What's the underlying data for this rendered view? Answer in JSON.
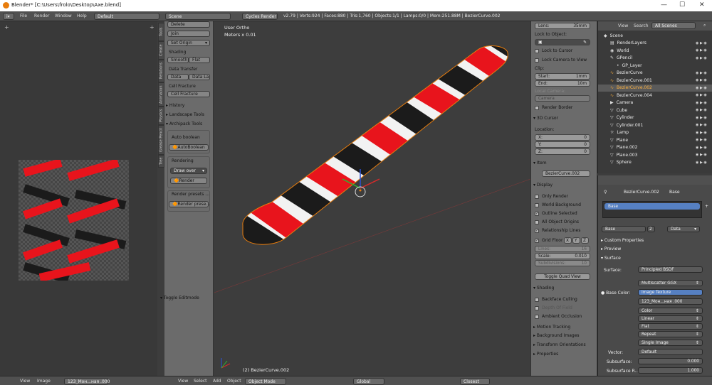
{
  "window": {
    "title": "Blender* [C:\\Users\\frolo\\Desktop\\Axe.blend]"
  },
  "menu": [
    "File",
    "Render",
    "Window",
    "Help"
  ],
  "layout": "Default",
  "scene": "Scene",
  "engine": "Cycles Render",
  "stats": "v2.79 | Verts:924 | Faces:880 | Tris:1,760 | Objects:1/1 | Lamps:0/0 | Mem:251.88M | BezierCurve.002",
  "tool_tabs": [
    "Tools",
    "Create",
    "Relations",
    "Animation",
    "Physics",
    "Grease Pencil",
    "Tree"
  ],
  "toolshelf": {
    "delete": "Delete",
    "join": "Join",
    "set_origin": "Set Origin",
    "shading": "Shading",
    "smooth": "Smooth",
    "flat": "Flat",
    "data_transfer": "Data Transfer",
    "data": "Data",
    "data_la": "Data La",
    "cell_fracture_lbl": "Cell Fracture",
    "cell_fracture_btn": "Cell Fracture",
    "history": "History",
    "landscape": "Landscape Tools",
    "archipack": "Archipack Tools",
    "auto_boolean_lbl": "Auto boolean",
    "auto_boolean_btn": "AutoBoolean",
    "rendering": "Rendering",
    "draw_over": "Draw over",
    "render": "Render",
    "render_presets_lbl": "Render presets ...",
    "render_presets_btn": "Render prese...",
    "toggle_editmode": "Toggle Editmode"
  },
  "viewport": {
    "view_name": "User Ortho",
    "scale": "Meters x 0.01",
    "object_label": "(2) BezierCurve.002"
  },
  "npanel": {
    "lens_lbl": "Lens:",
    "lens_val": "35mm",
    "lock_obj": "Lock to Object:",
    "lock_cursor": "Lock to Cursor",
    "lock_camera": "Lock Camera to View",
    "clip": "Clip:",
    "start_lbl": "Start:",
    "start_val": "1mm",
    "end_lbl": "End:",
    "end_val": "10m",
    "local_camera": "Local Camera:",
    "camera": "Camera",
    "render_border": "Render Border",
    "cursor3d": "3D Cursor",
    "location": "Location:",
    "x_lbl": "X:",
    "x_val": "0",
    "y_lbl": "Y:",
    "y_val": "0",
    "z_lbl": "Z:",
    "z_val": "0",
    "item": "Item",
    "item_name": "BezierCurve.002",
    "display": "Display",
    "only_render": "Only Render",
    "world_bg": "World Background",
    "outline_sel": "Outline Selected",
    "all_origins": "All Object Origins",
    "rel_lines": "Relationship Lines",
    "grid_floor": "Grid Floor",
    "gx": "X",
    "gy": "Y",
    "gz": "Z",
    "lines_lbl": "Lines:",
    "lines_val": "16",
    "scale_lbl": "Scale:",
    "scale_val": "0.010",
    "subdiv_lbl": "Subdivisions:",
    "subdiv_val": "10",
    "toggle_quad": "Toggle Quad View",
    "shading": "Shading",
    "backface": "Backface Culling",
    "dof": "Depth Of Field",
    "ao": "Ambient Occlusion",
    "motion": "Motion Tracking",
    "bg_images": "Background Images",
    "transform_orient": "Transform Orientations",
    "properties": "Properties"
  },
  "outliner": {
    "view": "View",
    "search": "Search",
    "all_scenes": "All Scenes",
    "rows": [
      {
        "name": "Scene",
        "indent": 0,
        "icon": "scene-icon"
      },
      {
        "name": "RenderLayers",
        "indent": 1,
        "icon": "layers-icon"
      },
      {
        "name": "World",
        "indent": 1,
        "icon": "world-icon"
      },
      {
        "name": "GPencil",
        "indent": 1,
        "icon": "pencil-icon"
      },
      {
        "name": "GP_Layer",
        "indent": 2,
        "icon": "dot-icon"
      },
      {
        "name": "BezierCurve",
        "indent": 1,
        "icon": "curve-icon"
      },
      {
        "name": "BezierCurve.001",
        "indent": 1,
        "icon": "curve-icon"
      },
      {
        "name": "BezierCurve.002",
        "indent": 1,
        "icon": "curve-icon",
        "selected": true
      },
      {
        "name": "BezierCurve.004",
        "indent": 1,
        "icon": "curve-icon"
      },
      {
        "name": "Camera",
        "indent": 1,
        "icon": "camera-icon"
      },
      {
        "name": "Cube",
        "indent": 1,
        "icon": "mesh-icon"
      },
      {
        "name": "Cylinder",
        "indent": 1,
        "icon": "mesh-icon"
      },
      {
        "name": "Cylinder.001",
        "indent": 1,
        "icon": "mesh-icon"
      },
      {
        "name": "Lamp",
        "indent": 1,
        "icon": "lamp-icon"
      },
      {
        "name": "Plane",
        "indent": 1,
        "icon": "mesh-icon"
      },
      {
        "name": "Plane.002",
        "indent": 1,
        "icon": "mesh-icon"
      },
      {
        "name": "Plane.003",
        "indent": 1,
        "icon": "mesh-icon"
      },
      {
        "name": "Sphere",
        "indent": 1,
        "icon": "mesh-icon"
      }
    ]
  },
  "props": {
    "obj": "BezierCurve.002",
    "mat": "Base",
    "slot": "Base",
    "users": "2",
    "data": "Data",
    "custom": "Custom Properties",
    "preview": "Preview",
    "surface_hdr": "Surface",
    "surface_lbl": "Surface:",
    "surface_val": "Principled BSDF",
    "distribution": "Multiscatter GGX",
    "base_color_lbl": "Base Color:",
    "base_color_val": "Image Texture",
    "image": "123_Мон...ная .000",
    "color": "Color",
    "linear": "Linear",
    "flat": "Flat",
    "repeat": "Repeat",
    "single_image": "Single Image",
    "vector_lbl": "Vector:",
    "vector_val": "Default",
    "subsurface_lbl": "Subsurface:",
    "subsurface_val": "0.000",
    "subsurface_r_lbl": "Subsurface R...",
    "sr1": "1.000",
    "sr2": "1.000"
  },
  "bottom": {
    "img_view": "View",
    "img_image": "Image",
    "img_name": "123_Мон...ная .000",
    "vp_view": "View",
    "vp_select": "Select",
    "vp_add": "Add",
    "vp_object": "Object",
    "mode": "Object Mode",
    "orientation": "Global",
    "snap": "Closest"
  },
  "colors": {
    "accent": "#e87d0d",
    "selection": "#5680c2",
    "red": "#e8141c",
    "black": "#1b1b1b"
  }
}
